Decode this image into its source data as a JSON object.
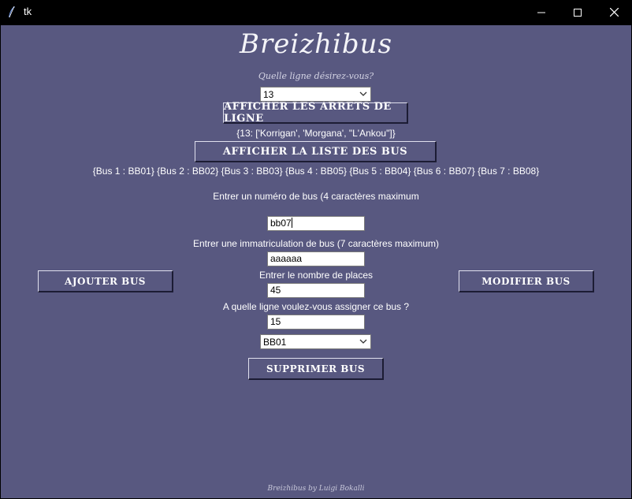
{
  "window": {
    "title": "tk",
    "icons": {
      "app": "feather-icon",
      "minimize": "minimize-icon",
      "maximize": "maximize-icon",
      "close": "close-icon"
    }
  },
  "app": {
    "title": "Breizhibus",
    "question": "Quelle ligne désirez-vous?",
    "line_select": {
      "value": "13"
    },
    "show_stops_button": "Afficher les arrets de ligne",
    "stops_result": "{13: ['Korrigan', 'Morgana', \"L'Ankou\"]}",
    "show_buses_button": "Afficher la liste des bus",
    "buses_result": "{Bus 1 : BB01} {Bus 2 : BB02} {Bus 3 : BB03} {Bus 4 : BB05} {Bus 5 : BB04} {Bus 6 : BB07} {Bus 7 : BB08}",
    "bus_number_label": "Entrer un numéro de bus (4 caractères maximum",
    "bus_number_value": "bb07",
    "registration_label": "Entrer une immatriculation  de bus (7 caractères maximum)",
    "registration_value": "aaaaaa",
    "seats_label": "Entrer le nombre de places",
    "seats_value": "45",
    "assign_line_label": "A quelle ligne voulez-vous assigner ce bus ?",
    "assign_line_value": "15",
    "bus_select": {
      "value": "BB01"
    },
    "add_button": "Ajouter bus",
    "modify_button": "Modifier bus",
    "delete_button": "Supprimer bus",
    "footer": "Breizhibus by Luigi Bokalli"
  },
  "colors": {
    "background": "#585880",
    "titlebar": "#000000",
    "text": "#ffffff"
  }
}
